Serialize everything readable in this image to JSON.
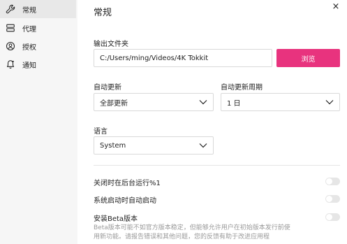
{
  "sidebar": {
    "items": [
      {
        "label": "常规",
        "icon": "wrench-icon",
        "active": true
      },
      {
        "label": "代理",
        "icon": "server-icon",
        "active": false
      },
      {
        "label": "授权",
        "icon": "user-circle-icon",
        "active": false
      },
      {
        "label": "通知",
        "icon": "bell-icon",
        "active": false
      }
    ]
  },
  "main": {
    "title": "常规",
    "close_label": "×",
    "output_folder": {
      "label": "输出文件夹",
      "value": "C:/Users/ming/Videos/4K Tokkit",
      "browse_label": "浏览"
    },
    "auto_update": {
      "label": "自动更新",
      "value": "全部更新"
    },
    "auto_update_period": {
      "label": "自动更新周期",
      "value": "1 日"
    },
    "language": {
      "label": "语言",
      "value": "System"
    },
    "toggles": [
      {
        "label": "关闭时在后台运行%1",
        "on": false
      },
      {
        "label": "系统启动时自动启动",
        "on": false
      },
      {
        "label": "安装Beta版本",
        "on": false
      }
    ],
    "beta_description": "Beta版本可能不如官方版本稳定，但能够允许用户在初始版本发行前使用新功能。请报告错误和其他问题，您的反馈有助于改进应用程"
  },
  "colors": {
    "accent": "#e8337e",
    "sidebar_bg": "#f6f6f6",
    "active_item_bg": "#e8e8e8"
  }
}
